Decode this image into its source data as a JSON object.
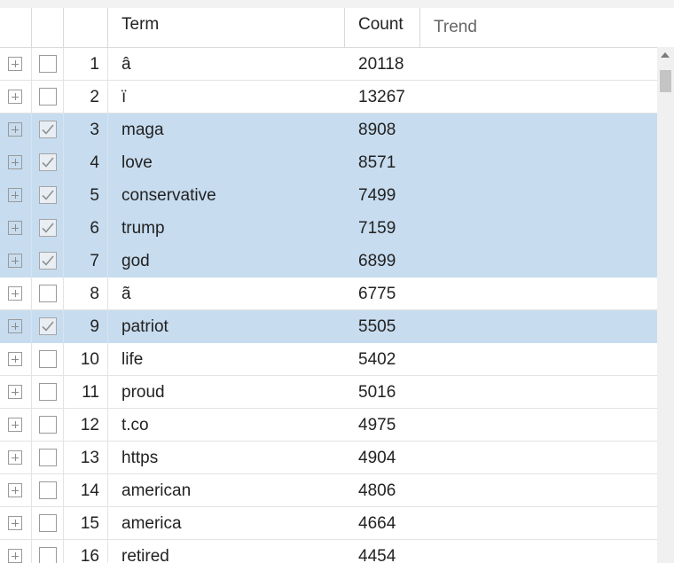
{
  "columns": {
    "term": "Term",
    "count": "Count",
    "trend": "Trend"
  },
  "rows": [
    {
      "rank": "1",
      "term": "â",
      "count": "20118",
      "selected": false
    },
    {
      "rank": "2",
      "term": "ï",
      "count": "13267",
      "selected": false
    },
    {
      "rank": "3",
      "term": "maga",
      "count": "8908",
      "selected": true
    },
    {
      "rank": "4",
      "term": "love",
      "count": "8571",
      "selected": true
    },
    {
      "rank": "5",
      "term": "conservative",
      "count": "7499",
      "selected": true
    },
    {
      "rank": "6",
      "term": "trump",
      "count": "7159",
      "selected": true
    },
    {
      "rank": "7",
      "term": "god",
      "count": "6899",
      "selected": true
    },
    {
      "rank": "8",
      "term": "ã",
      "count": "6775",
      "selected": false
    },
    {
      "rank": "9",
      "term": "patriot",
      "count": "5505",
      "selected": true
    },
    {
      "rank": "10",
      "term": "life",
      "count": "5402",
      "selected": false
    },
    {
      "rank": "11",
      "term": "proud",
      "count": "5016",
      "selected": false
    },
    {
      "rank": "12",
      "term": "t.co",
      "count": "4975",
      "selected": false
    },
    {
      "rank": "13",
      "term": "https",
      "count": "4904",
      "selected": false
    },
    {
      "rank": "14",
      "term": "american",
      "count": "4806",
      "selected": false
    },
    {
      "rank": "15",
      "term": "america",
      "count": "4664",
      "selected": false
    },
    {
      "rank": "16",
      "term": "retired",
      "count": "4454",
      "selected": false
    }
  ],
  "colors": {
    "selected_row": "#c7dcef",
    "grid_line": "#e3e3e3",
    "header_text": "#666666"
  },
  "icons": {
    "expand": "plus-box-icon",
    "checkbox": "checkbox-icon",
    "scroll_up": "up-arrow-icon"
  }
}
